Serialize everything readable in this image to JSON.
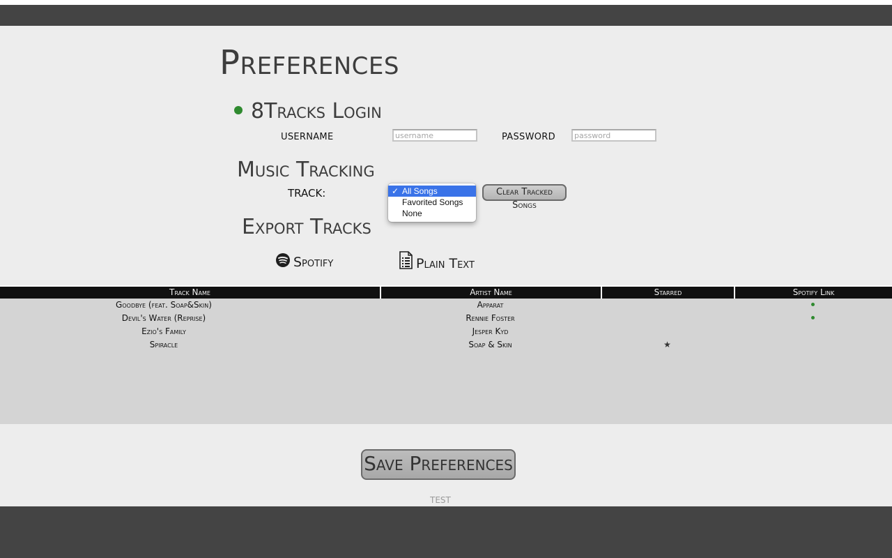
{
  "page": {
    "title": "Preferences"
  },
  "login": {
    "title": "8Tracks Login",
    "status_color": "#2f8a2f",
    "username_label": "USERNAME",
    "username_placeholder": "username",
    "username_value": "",
    "password_label": "PASSWORD",
    "password_placeholder": "password",
    "password_value": ""
  },
  "tracking": {
    "title": "Music Tracking",
    "track_label": "TRACK:",
    "options": [
      "All Songs",
      "Favorited Songs",
      "None"
    ],
    "selected": "All Songs",
    "clear_button": "Clear Tracked Songs"
  },
  "export": {
    "title": "Export Tracks",
    "spotify_label": "Spotify",
    "spotify_icon": "spotify-icon",
    "plain_text_label": "Plain Text",
    "plain_text_icon": "document-icon"
  },
  "table": {
    "headers": [
      "Track Name",
      "Artist Name",
      "Starred",
      "Spotify Link"
    ],
    "rows": [
      {
        "track": "Goodbye (feat. Soap&Skin)",
        "artist": "Apparat",
        "starred": "",
        "spotify": "●"
      },
      {
        "track": "Devil's Water (Reprise)",
        "artist": "Rennie Foster",
        "starred": "",
        "spotify": "●"
      },
      {
        "track": "Ezio's Family",
        "artist": "Jesper Kyd",
        "starred": "",
        "spotify": ""
      },
      {
        "track": "Spiracle",
        "artist": "Soap & Skin",
        "starred": "★",
        "spotify": ""
      }
    ]
  },
  "save_button": "Save Preferences",
  "footer_note": "TEST"
}
